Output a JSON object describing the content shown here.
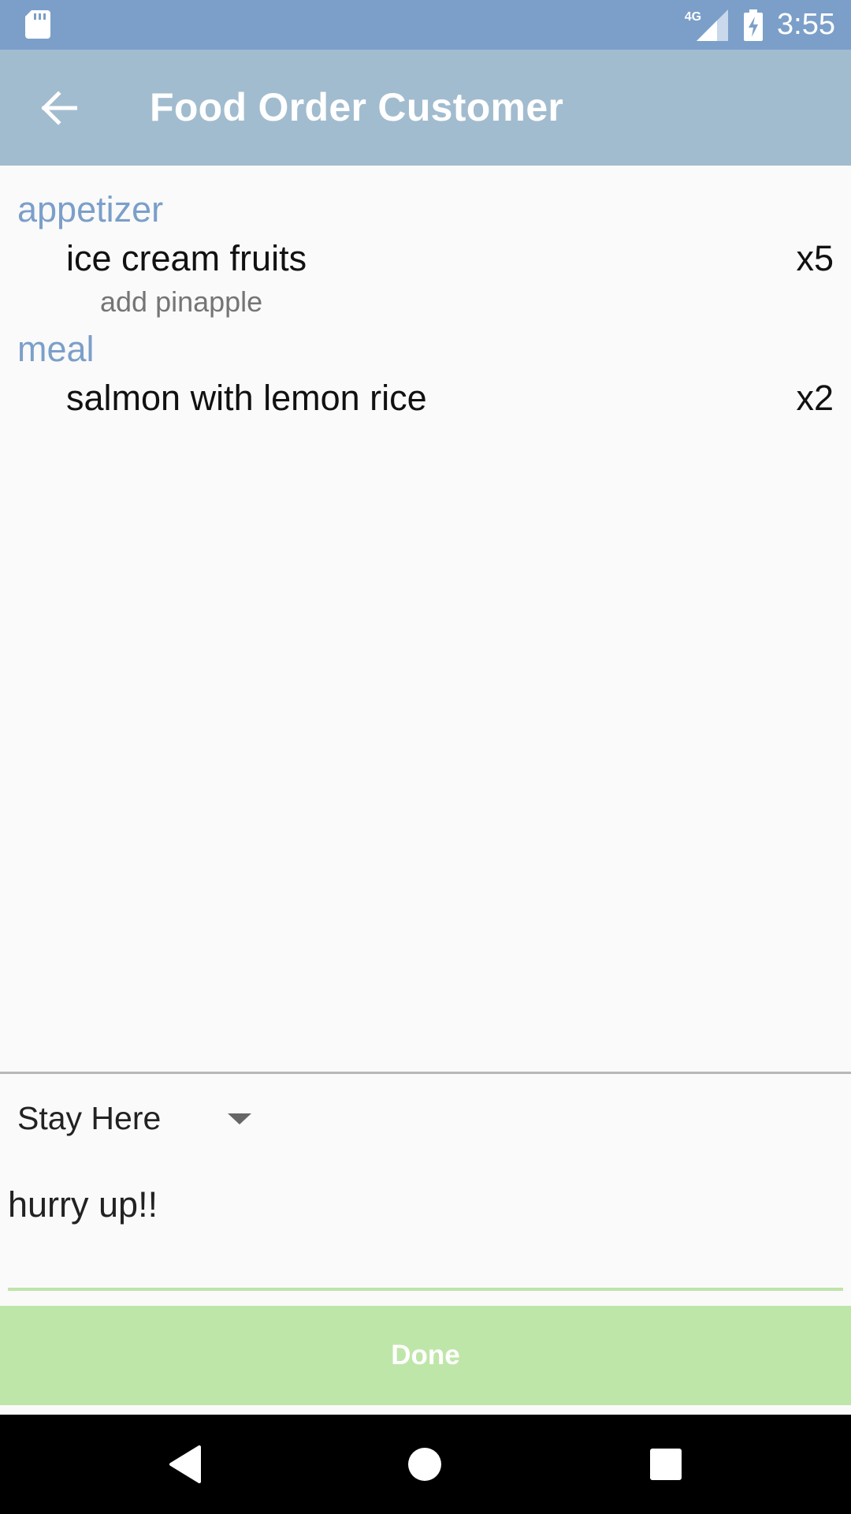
{
  "status_bar": {
    "network_label": "4G",
    "time": "3:55",
    "icons": [
      "sd-card-icon",
      "signal-icon",
      "battery-charging-icon"
    ]
  },
  "app_bar": {
    "title": "Food Order Customer",
    "back_icon": "arrow-left-icon"
  },
  "order": {
    "groups": [
      {
        "category": "appetizer",
        "items": [
          {
            "name": "ice cream fruits",
            "quantity": "x5",
            "note": "add pinapple"
          }
        ]
      },
      {
        "category": "meal",
        "items": [
          {
            "name": "salmon with lemon rice",
            "quantity": "x2",
            "note": ""
          }
        ]
      }
    ]
  },
  "options": {
    "dine_option": "Stay Here",
    "comment_value": "hurry up!!"
  },
  "actions": {
    "done_label": "Done"
  },
  "colors": {
    "status_bar": "#7b9fc9",
    "app_bar": "#a2bccf",
    "category_text": "#7b9fc9",
    "done_button": "#bfe6a9",
    "accent_underline": "#bfe4a9"
  },
  "nav_bar": {
    "icons": [
      "back-triangle-icon",
      "home-circle-icon",
      "recents-square-icon"
    ]
  }
}
